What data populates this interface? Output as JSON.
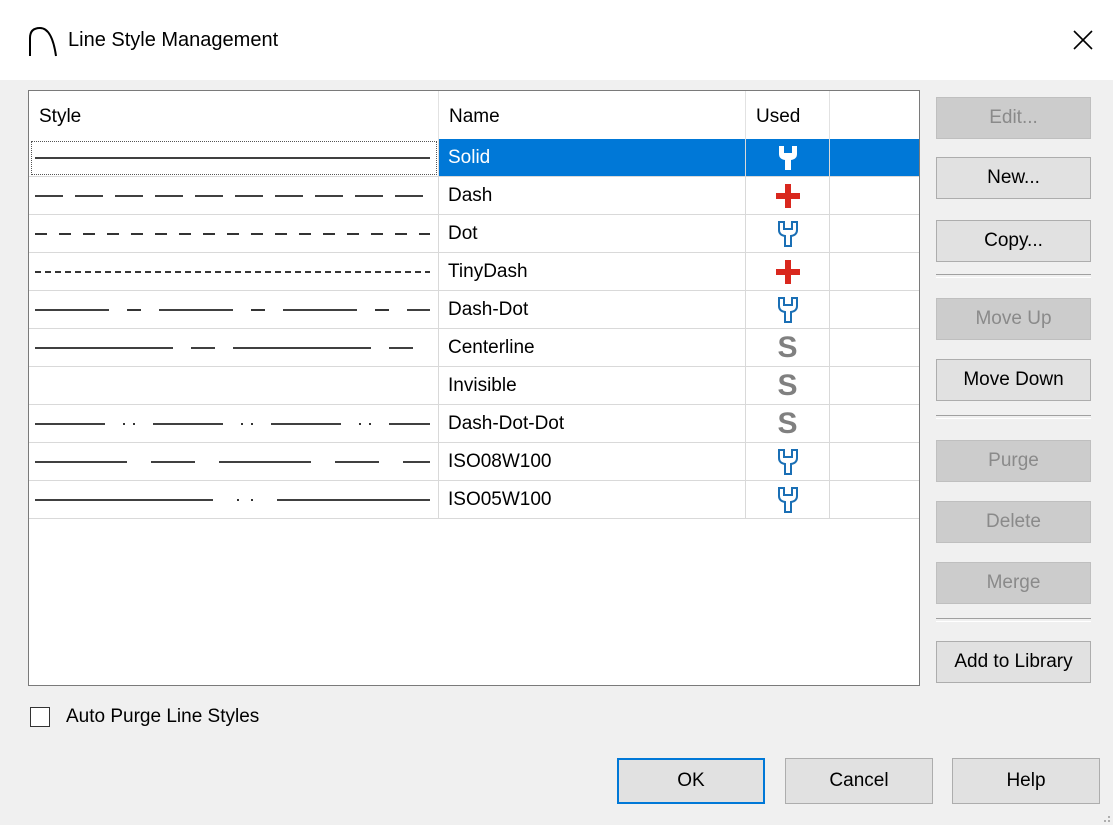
{
  "window": {
    "title": "Line Style Management",
    "app_icon": "arc-icon",
    "close_icon": "close-icon"
  },
  "columns": {
    "style": "Style",
    "name": "Name",
    "used": "Used"
  },
  "rows": [
    {
      "name": "Solid",
      "pattern": "solid",
      "used_icon": "wrench-filled-icon",
      "selected": true
    },
    {
      "name": "Dash",
      "pattern": "dash",
      "used_icon": "red-cross-icon"
    },
    {
      "name": "Dot",
      "pattern": "dot",
      "used_icon": "wrench-outline-icon"
    },
    {
      "name": "TinyDash",
      "pattern": "tinydash",
      "used_icon": "red-cross-icon"
    },
    {
      "name": "Dash-Dot",
      "pattern": "dashdot",
      "used_icon": "wrench-outline-icon"
    },
    {
      "name": "Centerline",
      "pattern": "centerline",
      "used_icon": "s-icon"
    },
    {
      "name": "Invisible",
      "pattern": "invisible",
      "used_icon": "s-icon"
    },
    {
      "name": "Dash-Dot-Dot",
      "pattern": "dashdotdot",
      "used_icon": "s-icon"
    },
    {
      "name": "ISO08W100",
      "pattern": "iso08",
      "used_icon": "wrench-outline-icon"
    },
    {
      "name": "ISO05W100",
      "pattern": "iso05",
      "used_icon": "wrench-outline-icon"
    }
  ],
  "used_s_glyph": "S",
  "buttons": {
    "edit": "Edit...",
    "new": "New...",
    "copy": "Copy...",
    "move_up": "Move Up",
    "move_down": "Move Down",
    "purge": "Purge",
    "delete": "Delete",
    "merge": "Merge",
    "add_to_library": "Add to Library"
  },
  "auto_purge": {
    "label": "Auto Purge Line Styles",
    "checked": false
  },
  "dialog_buttons": {
    "ok": "OK",
    "cancel": "Cancel",
    "help": "Help"
  },
  "colors": {
    "selection": "#0078d7",
    "used_blue": "#1a6fb5",
    "used_red": "#d9281e",
    "used_gray": "#808080"
  }
}
